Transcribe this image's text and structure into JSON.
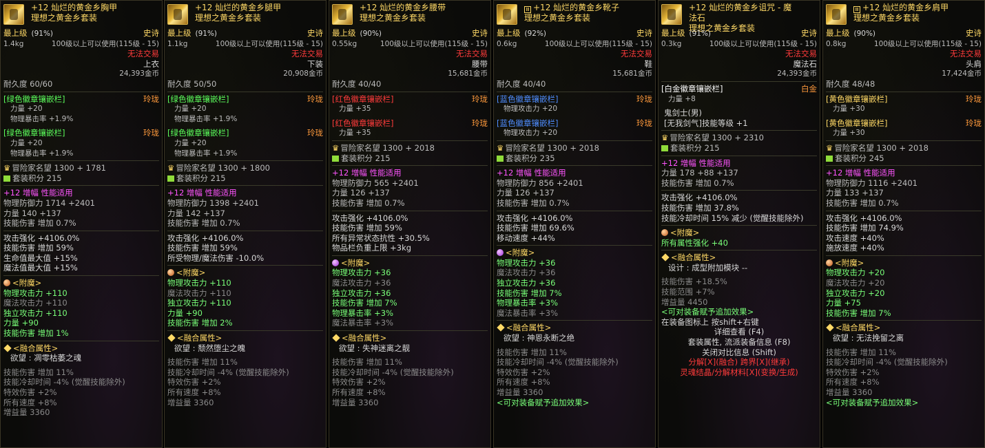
{
  "panels": [
    {
      "title": "+12 灿烂的黄金乡胸甲",
      "set": "理想之黄金乡套装",
      "lock": false,
      "grade": "最上级",
      "pct": "(91%)",
      "rarity": "史诗",
      "weight": "1.4kg",
      "req": "100级以上可以使用(115级 - 15)",
      "trade": "无法交易",
      "slot": "上衣",
      "price": "24,393金币",
      "durability": "耐久度 60/60",
      "sockets": [
        {
          "name": "[绿色徽章镶嵌栏]",
          "color": "g",
          "tag": "玲珑",
          "stats": [
            "力量 +20",
            "物理暴击率 +1.9%"
          ]
        },
        {
          "name": "[绿色徽章镶嵌栏]",
          "color": "g",
          "tag": "玲珑",
          "stats": [
            "力量 +20",
            "物理暴击率 +1.9%"
          ]
        }
      ],
      "fame": "冒险家名望 1300 + 1781",
      "setscore": "套装积分 215",
      "amp": "+12 增幅 性能适用",
      "base": [
        "物理防御力 1714 +2401",
        "力量 140 +137",
        "技能伤害 增加 0.7%"
      ],
      "extra": [
        "攻击强化 +4106.0%",
        "技能伤害 增加 59%",
        "生命值最大值 +15%",
        "魔法值最大值 +15%"
      ],
      "enchant_title": "<附魔>",
      "enchant_orb": "or",
      "enchant": [
        [
          "物理攻击力 +110",
          "g"
        ],
        [
          "魔法攻击力 +110",
          "gr"
        ],
        [
          "独立攻击力 +110",
          "g"
        ],
        [
          "力量 +90",
          "g"
        ],
        [
          "技能伤害 增加 1%",
          "g"
        ]
      ],
      "fusion_title": "<融合属性>",
      "fusion": "欲望 : 凋零枯萎之魂",
      "tail": [
        "技能伤害 增加 11%",
        "技能冷却时间 -4% (觉醒技能除外)",
        "特效伤害 +2%",
        "所有速度 +8%",
        "增益量 3360"
      ],
      "footer": []
    },
    {
      "title": "+12 灿烂的黄金乡腿甲",
      "set": "理想之黄金乡套装",
      "lock": false,
      "grade": "最上级",
      "pct": "(91%)",
      "rarity": "史诗",
      "weight": "1.1kg",
      "req": "100级以上可以使用(115级 - 15)",
      "trade": "无法交易",
      "slot": "下装",
      "price": "20,908金币",
      "durability": "耐久度 50/50",
      "sockets": [
        {
          "name": "[绿色徽章镶嵌栏]",
          "color": "g",
          "tag": "玲珑",
          "stats": [
            "力量 +20",
            "物理暴击率 +1.9%"
          ]
        },
        {
          "name": "[绿色徽章镶嵌栏]",
          "color": "g",
          "tag": "玲珑",
          "stats": [
            "力量 +20",
            "物理暴击率 +1.9%"
          ]
        }
      ],
      "fame": "冒险家名望 1300 + 1800",
      "setscore": "套装积分 215",
      "amp": "+12 增幅 性能适用",
      "base": [
        "物理防御力 1398 +2401",
        "力量 142 +137",
        "技能伤害 增加 0.7%"
      ],
      "extra": [
        "攻击强化 +4106.0%",
        "技能伤害 增加 59%",
        "所受物理/魔法伤害 -10.0%"
      ],
      "enchant_title": "<附魔>",
      "enchant_orb": "or",
      "enchant": [
        [
          "物理攻击力 +110",
          "g"
        ],
        [
          "魔法攻击力 +110",
          "gr"
        ],
        [
          "独立攻击力 +110",
          "g"
        ],
        [
          "力量 +90",
          "g"
        ],
        [
          "技能伤害 增加 2%",
          "g"
        ]
      ],
      "fusion_title": "<融合属性>",
      "fusion": "欲望 : 颓然堕尘之魄",
      "tail": [
        "技能伤害 增加 11%",
        "技能冷却时间 -4% (觉醒技能除外)",
        "特效伤害 +2%",
        "所有速度 +8%",
        "增益量 3360"
      ],
      "footer": []
    },
    {
      "title": "+12 灿烂的黄金乡腰带",
      "set": "理想之黄金乡套装",
      "lock": false,
      "grade": "最上级",
      "pct": "(90%)",
      "rarity": "史诗",
      "weight": "0.55kg",
      "req": "100级以上可以使用(115级 - 15)",
      "trade": "无法交易",
      "slot": "腰带",
      "price": "15,681金币",
      "durability": "耐久度 40/40",
      "sockets": [
        {
          "name": "[红色徽章镶嵌栏]",
          "color": "rsock",
          "tag": "玲珑",
          "stats": [
            "力量 +35"
          ]
        },
        {
          "name": "[红色徽章镶嵌栏]",
          "color": "rsock",
          "tag": "玲珑",
          "stats": [
            "力量 +35"
          ]
        }
      ],
      "fame": "冒险家名望 1300 + 2018",
      "setscore": "套装积分 215",
      "amp": "+12 增幅 性能适用",
      "base": [
        "物理防御力 565 +2401",
        "力量 126 +137",
        "技能伤害 增加 0.7%"
      ],
      "extra": [
        "攻击强化 +4106.0%",
        "技能伤害 增加 59%",
        "所有异常状态抗性 +30.5%",
        "物品栏负重上限 +3kg"
      ],
      "enchant_title": "<附魔>",
      "enchant_orb": "pu",
      "enchant": [
        [
          "物理攻击力 +36",
          "g"
        ],
        [
          "魔法攻击力 +36",
          "gr"
        ],
        [
          "独立攻击力 +36",
          "g"
        ],
        [
          "技能伤害 增加 7%",
          "g"
        ],
        [
          "物理暴击率 +3%",
          "g"
        ],
        [
          "魔法暴击率 +3%",
          "gr"
        ]
      ],
      "fusion_title": "<融合属性>",
      "fusion": "欲望 : 失神迷离之靓",
      "tail": [
        "技能伤害 增加 11%",
        "技能冷却时间 -4% (觉醒技能除外)",
        "特效伤害 +2%",
        "所有速度 +8%",
        "增益量 3360"
      ],
      "footer": []
    },
    {
      "title": "+12 灿烂的黄金乡靴子",
      "set": "理想之黄金乡套装",
      "lock": true,
      "grade": "最上级",
      "pct": "(92%)",
      "rarity": "史诗",
      "weight": "0.6kg",
      "req": "100级以上可以使用(115级 - 15)",
      "trade": "无法交易",
      "slot": "鞋",
      "price": "15,681金币",
      "durability": "耐久度 40/40",
      "sockets": [
        {
          "name": "[蓝色徽章镶嵌栏]",
          "color": "blue",
          "tag": "玲珑",
          "stats": [
            "物理攻击力 +20"
          ]
        },
        {
          "name": "[蓝色徽章镶嵌栏]",
          "color": "blue",
          "tag": "玲珑",
          "stats": [
            "物理攻击力 +20"
          ]
        }
      ],
      "fame": "冒险家名望 1300 + 2018",
      "setscore": "套装积分 235",
      "amp": "+12 增幅 性能适用",
      "base": [
        "物理防御力 856 +2401",
        "力量 126 +137",
        "技能伤害 增加 0.7%"
      ],
      "extra": [
        "攻击强化 +4106.0%",
        "技能伤害 增加 69.6%",
        "移动速度 +44%"
      ],
      "enchant_title": "<附魔>",
      "enchant_orb": "pu",
      "enchant": [
        [
          "物理攻击力 +36",
          "g"
        ],
        [
          "魔法攻击力 +36",
          "gr"
        ],
        [
          "独立攻击力 +36",
          "g"
        ],
        [
          "技能伤害 增加 7%",
          "g"
        ],
        [
          "物理暴击率 +3%",
          "g"
        ],
        [
          "魔法暴击率 +3%",
          "gr"
        ]
      ],
      "fusion_title": "<融合属性>",
      "fusion": "欲望 : 神恩永断之绝",
      "tail": [
        "技能伤害 增加 11%",
        "技能冷却时间 -4% (觉醒技能除外)",
        "特效伤害 +2%",
        "所有速度 +8%",
        "增益量 3360"
      ],
      "footer": [
        "<可对装备赋予追加效果>"
      ]
    },
    {
      "title": "+12 灿烂的黄金乡诅咒 - 魔",
      "title2": "法石",
      "set": "理想之黄金乡套装",
      "lock": false,
      "grade": "最上级",
      "pct": "(91%)",
      "rarity": "史诗",
      "weight": "0.3kg",
      "req": "100级以上可以使用(115级 - 15)",
      "trade": "无法交易",
      "slot": "魔法石",
      "price": "24,393金币",
      "durability": "",
      "sockets": [
        {
          "name": "[白金徽章镶嵌栏]",
          "color": "wsock",
          "tag": "白金",
          "stats": [
            "力量 +8"
          ]
        }
      ],
      "skill": [
        "鬼剑士(男)",
        "[无我剑气]技能等级 +1"
      ],
      "fame": "冒险家名望 1300 + 2310",
      "setscore": "套装积分 215",
      "amp": "+12 增幅 性能适用",
      "base": [
        "力量 178 +88 +137",
        "技能伤害 增加 0.7%"
      ],
      "extra": [
        "攻击强化 +4106.0%",
        "技能伤害 增加 37.8%",
        "技能冷却时间 15% 减少 (觉醒技能除外)"
      ],
      "enchant_title": "<附魔>",
      "enchant_orb": "or",
      "enchant": [
        [
          "所有属性强化 +40",
          "g"
        ]
      ],
      "fusion_title": "<融合属性>",
      "fusion": "设计 : 成型附加模块 --",
      "tail": [
        "技能伤害 +18.5%",
        "技能范围 +7%",
        "增益量 4450"
      ],
      "footer": [
        "<可对装备赋予追加效果>",
        "在装备图标上 按shift+右键",
        "详细查看 (F4)",
        "套装属性, 流派装备信息 (F8)",
        "关闭对比信息 (Shift)",
        "分解[X](融合)  跨界[X](继承)",
        "灵魂结晶/分解材料[X](变换/生成)"
      ]
    },
    {
      "title": "+12 灿烂的黄金乡肩甲",
      "set": "理想之黄金乡套装",
      "lock": true,
      "grade": "最上级",
      "pct": "(90%)",
      "rarity": "史诗",
      "weight": "0.8kg",
      "req": "100级以上可以使用(115级 - 15)",
      "trade": "无法交易",
      "slot": "头肩",
      "price": "17,424金币",
      "durability": "耐久度 48/48",
      "sockets": [
        {
          "name": "[黄色徽章镶嵌栏]",
          "color": "ysock",
          "tag": "玲珑",
          "stats": [
            "力量 +30"
          ]
        },
        {
          "name": "[黄色徽章镶嵌栏]",
          "color": "ysock",
          "tag": "玲珑",
          "stats": [
            "力量 +30"
          ]
        }
      ],
      "fame": "冒险家名望 1300 + 2018",
      "setscore": "套装积分 245",
      "amp": "+12 增幅 性能适用",
      "base": [
        "物理防御力 1116 +2401",
        "力量 133 +137",
        "技能伤害 增加 0.7%"
      ],
      "extra": [
        "攻击强化 +4106.0%",
        "技能伤害 增加 74.9%",
        "攻击速度 +40%",
        "施放速度 +40%"
      ],
      "enchant_title": "<附魔>",
      "enchant_orb": "or",
      "enchant": [
        [
          "物理攻击力 +20",
          "g"
        ],
        [
          "魔法攻击力 +20",
          "gr"
        ],
        [
          "独立攻击力 +20",
          "g"
        ],
        [
          "力量 +75",
          "g"
        ],
        [
          "技能伤害 增加 7%",
          "g"
        ]
      ],
      "fusion_title": "<融合属性>",
      "fusion": "欲望 : 无法挽留之离",
      "tail": [
        "技能伤害 增加 11%",
        "技能冷却时间 -4% (觉醒技能除外)",
        "特效伤害 +2%",
        "所有速度 +8%",
        "增益量 3360"
      ],
      "footer": [
        "<可对装备赋予追加效果>"
      ]
    }
  ]
}
